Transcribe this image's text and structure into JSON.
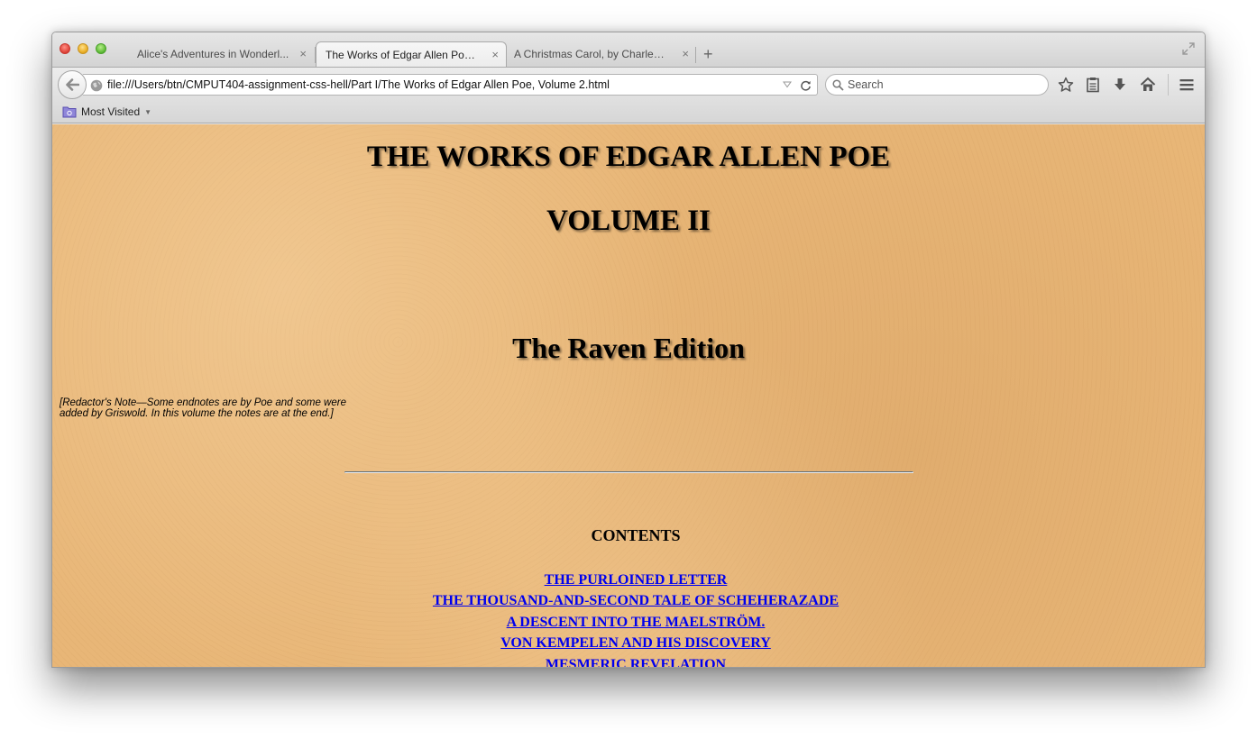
{
  "browser": {
    "tabs": [
      {
        "label": "Alice's Adventures in Wonderl...",
        "close": "×"
      },
      {
        "label": "The Works of Edgar Allen Poe,...",
        "close": "×",
        "active": true
      },
      {
        "label": "A Christmas Carol, by Charles ...",
        "close": "×"
      }
    ],
    "new_tab": "+",
    "url": "file:///Users/btn/CMPUT404-assignment-css-hell/Part I/The Works of Edgar Allen Poe, Volume 2.html",
    "search_placeholder": "Search",
    "bookmarks": {
      "most_visited": "Most Visited"
    },
    "icons": [
      "back-arrow-icon",
      "globe-icon",
      "reload-icon",
      "search-icon",
      "bookmark-star-icon",
      "reading-list-icon",
      "downloads-icon",
      "home-icon",
      "menu-icon",
      "folder-icon",
      "fullscreen-icon"
    ]
  },
  "page": {
    "title": "THE WORKS OF EDGAR ALLEN POE",
    "volume": "VOLUME II",
    "edition": "The Raven Edition",
    "note": "[Redactor's Note—Some endnotes are by Poe and some were added by Griswold. In this volume the notes are at the end.]",
    "contents_heading": "CONTENTS",
    "toc": [
      "THE PURLOINED LETTER",
      "THE THOUSAND-AND-SECOND TALE OF SCHEHERAZADE",
      "A DESCENT INTO THE MAELSTRÖM.",
      "VON KEMPELEN AND HIS DISCOVERY",
      "MESMERIC REVELATION"
    ]
  },
  "colors": {
    "page_background": "#e8b677",
    "link": "#0000ee",
    "divider": "#5e6d79"
  }
}
